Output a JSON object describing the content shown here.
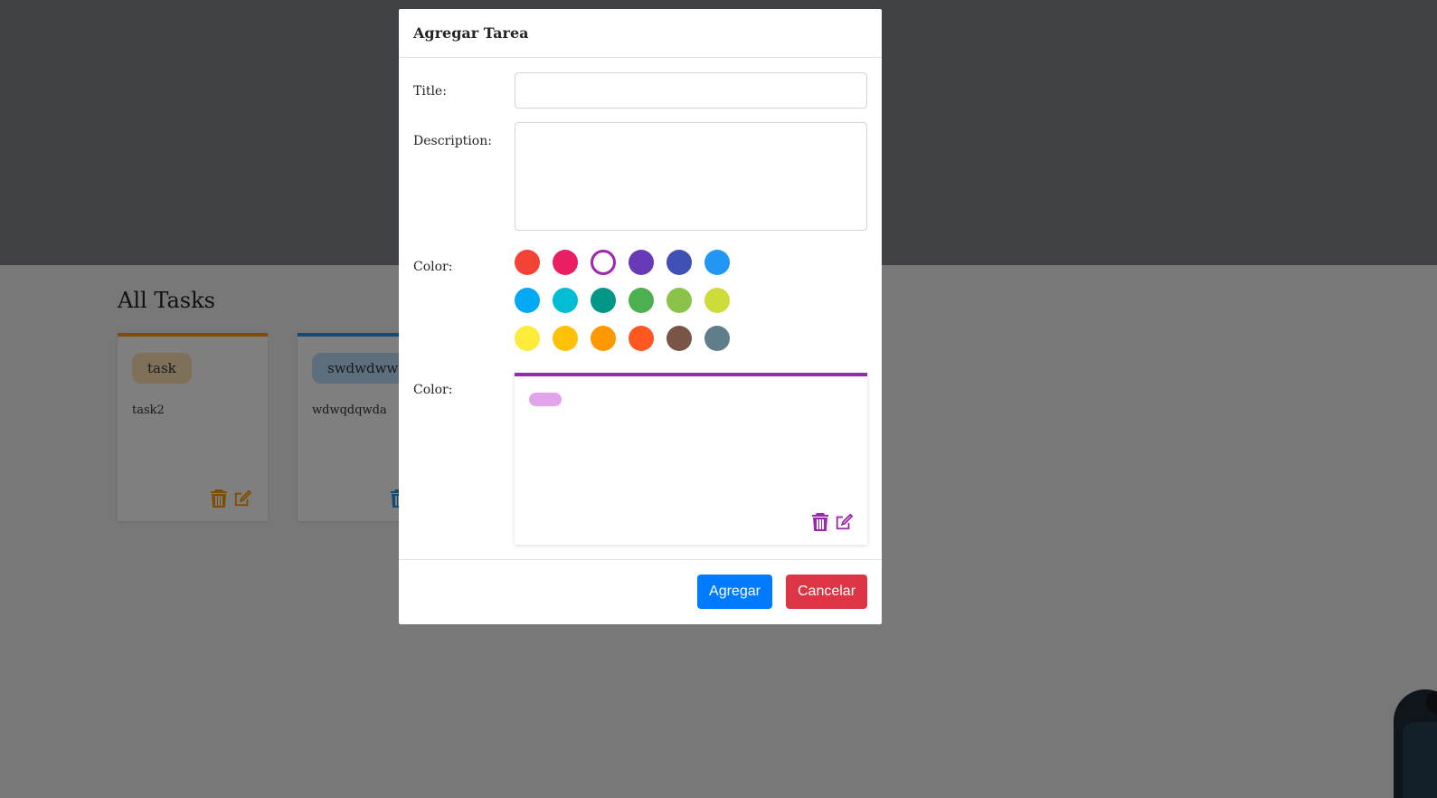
{
  "page": {
    "section_title": "All Tasks",
    "tasks": [
      {
        "chip": "task",
        "description": "task2",
        "color": "#ff9800",
        "chip_bg": "#ffe0b2"
      },
      {
        "chip": "swdwdwwdwd",
        "description": "wdwqdqwda",
        "color": "#2196f3",
        "chip_bg": "#bbdefb"
      }
    ]
  },
  "modal": {
    "title": "Agregar Tarea",
    "title_label": "Title:",
    "title_value": "",
    "description_label": "Description:",
    "description_value": "",
    "color_label": "Color:",
    "preview_label": "Color:",
    "selected_color": "#9c27b0",
    "colors": [
      "#f44336",
      "#e91e63",
      "#9c27b0",
      "#673ab7",
      "#3f51b5",
      "#2196f3",
      "#03a9f4",
      "#00bcd4",
      "#009688",
      "#4caf50",
      "#8bc34a",
      "#cddc39",
      "#ffeb3b",
      "#ffc107",
      "#ff9800",
      "#ff5722",
      "#795548",
      "#607d8b"
    ],
    "submit_label": "Agregar",
    "cancel_label": "Cancelar"
  }
}
